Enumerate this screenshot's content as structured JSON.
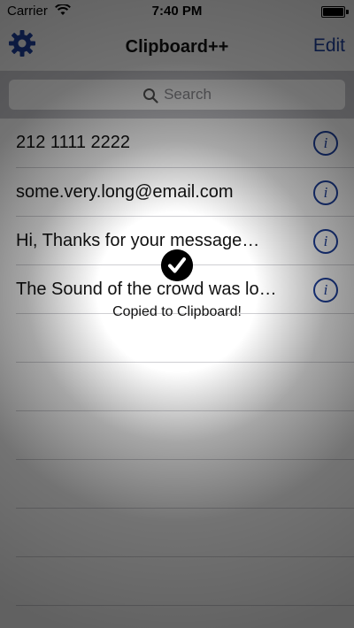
{
  "status_bar": {
    "carrier": "Carrier",
    "time": "7:40 PM"
  },
  "nav": {
    "title": "Clipboard++",
    "edit_label": "Edit",
    "settings_icon": "gear-icon"
  },
  "search": {
    "placeholder": "Search"
  },
  "clips": [
    {
      "text": "212 1111 2222"
    },
    {
      "text": "some.very.long@email.com"
    },
    {
      "text": "Hi, Thanks for your message…"
    },
    {
      "text": "The Sound of the crowd was lo…"
    }
  ],
  "hud": {
    "message": "Copied to Clipboard!",
    "icon": "checkmark-icon"
  },
  "colors": {
    "accent": "#1d3f9b"
  }
}
